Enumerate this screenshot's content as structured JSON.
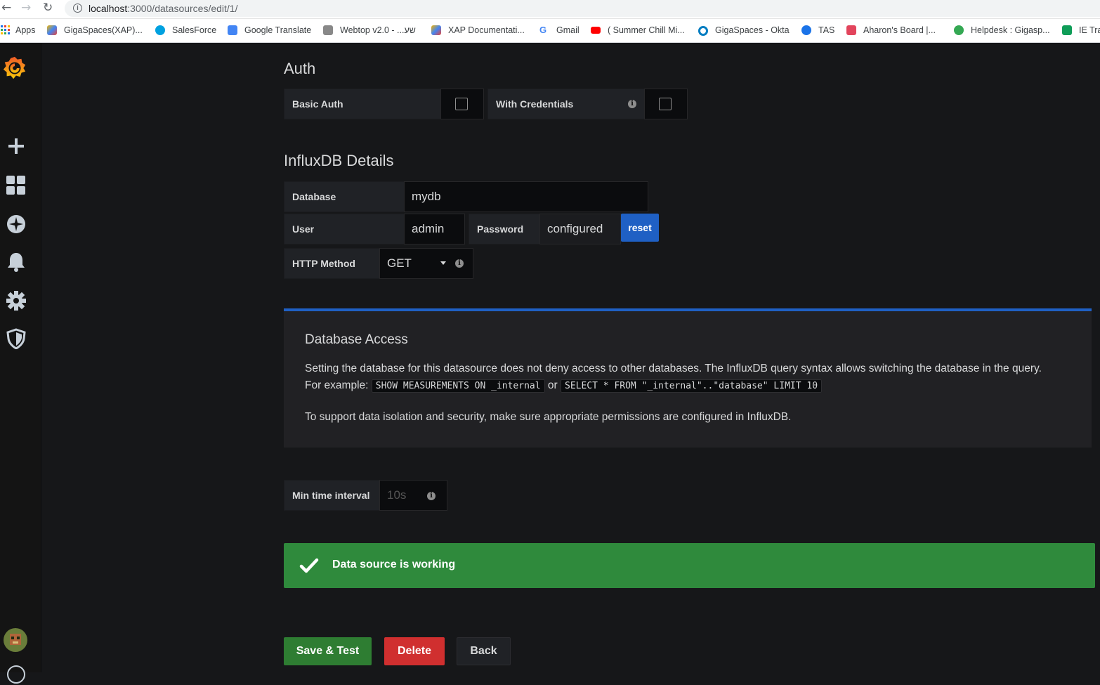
{
  "browser": {
    "url_host": "localhost",
    "url_path": ":3000/datasources/edit/1/",
    "bookmarks": [
      {
        "label": "Apps",
        "color": "#ea4335"
      },
      {
        "label": "GigaSpaces(XAP)...",
        "color": "#f4b400"
      },
      {
        "label": "SalesForce",
        "color": "#00a1e0"
      },
      {
        "label": "Google Translate",
        "color": "#4285f4"
      },
      {
        "label": "Webtop v2.0 - ...שע",
        "color": "#666666"
      },
      {
        "label": "XAP Documentati...",
        "color": "#f4b400"
      },
      {
        "label": "Gmail",
        "color": "#ea4335"
      },
      {
        "label": "( Summer Chill Mi...",
        "color": "#ff0000"
      },
      {
        "label": "GigaSpaces - Okta",
        "color": "#007dc1"
      },
      {
        "label": "TAS",
        "color": "#1a73e8"
      },
      {
        "label": "Aharon's Board |...",
        "color": "#e2445c"
      },
      {
        "label": "Helpdesk : Gigasp...",
        "color": "#34a853"
      },
      {
        "label": "IE Tra",
        "color": "#0f9d58"
      }
    ]
  },
  "sidebar": {
    "icons": [
      "grafana-logo-icon",
      "plus-icon",
      "dashboards-icon",
      "explore-icon",
      "alerting-bell-icon",
      "configuration-gear-icon",
      "server-admin-shield-icon",
      "user-avatar-icon",
      "help-icon"
    ],
    "accent": "#f05a28"
  },
  "auth": {
    "title": "Auth",
    "basic_auth_label": "Basic Auth",
    "with_credentials_label": "With Credentials"
  },
  "influx": {
    "title": "InfluxDB Details",
    "database_label": "Database",
    "database_value": "mydb",
    "user_label": "User",
    "user_value": "admin",
    "password_label": "Password",
    "password_value": "configured",
    "reset_label": "reset",
    "http_method_label": "HTTP Method",
    "http_method_value": "GET"
  },
  "access": {
    "title": "Database Access",
    "text_part1": "Setting the database for this datasource does not deny access to other databases. The InfluxDB query syntax allows switching the database in the query. For example:",
    "code1": "SHOW MEASUREMENTS ON _internal",
    "or": "or",
    "code2": "SELECT * FROM \"_internal\"..\"database\" LIMIT 10",
    "text2": "To support data isolation and security, make sure appropriate permissions are configured in InfluxDB."
  },
  "min_interval": {
    "label": "Min time interval",
    "placeholder": "10s"
  },
  "status": {
    "message": "Data source is working",
    "color": "#2f8a3c"
  },
  "actions": {
    "save_label": "Save & Test",
    "delete_label": "Delete",
    "back_label": "Back"
  }
}
